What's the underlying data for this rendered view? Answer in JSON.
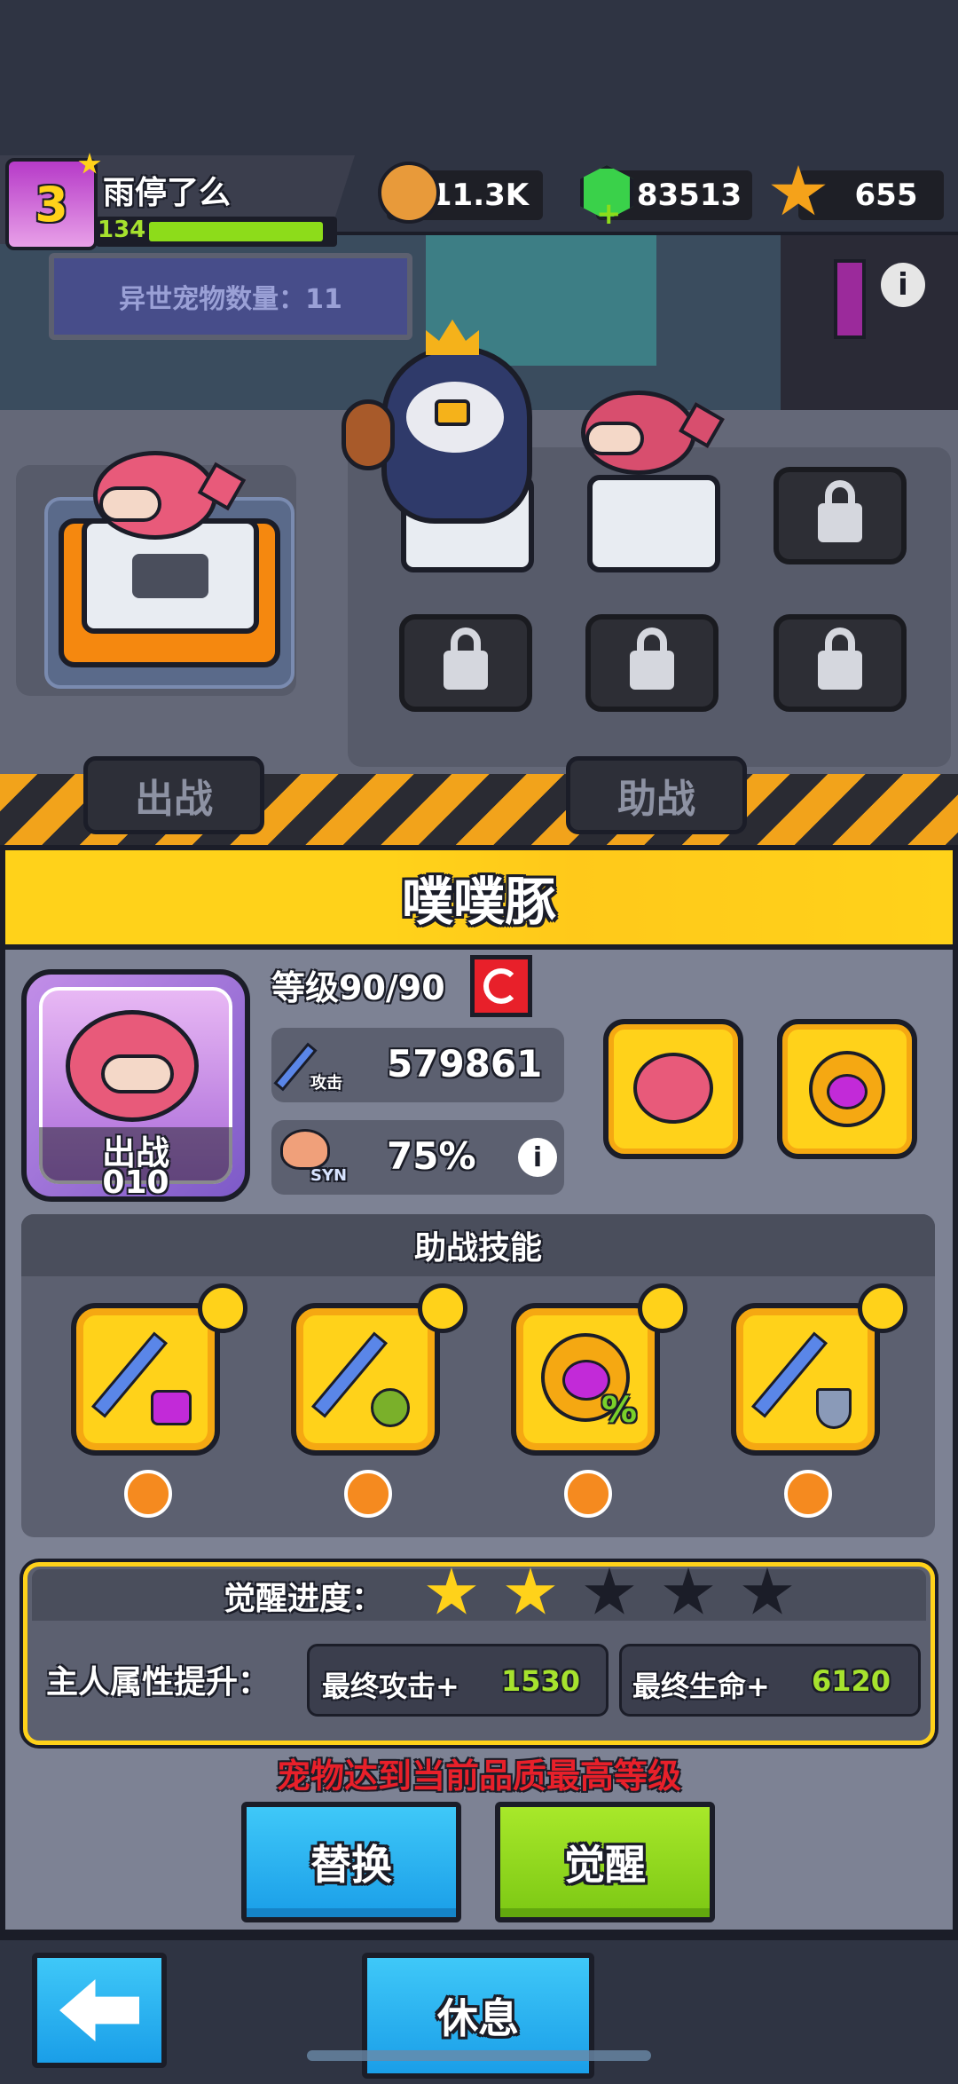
{
  "player": {
    "avatar_badge": "3",
    "name": "雨停了么",
    "level": "134",
    "xp_progress": 0.95
  },
  "currencies": {
    "coins": "11.3K",
    "gems": "83513",
    "stars": "655"
  },
  "scene": {
    "pet_count_label": "异世宠物数量：11",
    "info_icon": "i",
    "battle_label": "出战",
    "assist_label": "助战"
  },
  "pet": {
    "name": "噗噗豚",
    "level_label": "等级90/90",
    "attack_label": "攻击",
    "attack_value": "579861",
    "syn_label": "SYN",
    "syn_value": "75%",
    "card_status": "出战",
    "card_number": "010"
  },
  "assist_skills": {
    "title": "助战技能",
    "skills": [
      {
        "icon": "sword-purple-debuff-icon"
      },
      {
        "icon": "sword-poison-skull-icon"
      },
      {
        "icon": "cat-orb-percent-icon"
      },
      {
        "icon": "sword-shield-icon"
      }
    ]
  },
  "awakening": {
    "progress_label": "觉醒进度：",
    "stars_filled": 2,
    "stars_total": 5,
    "owner_boost_label": "主人属性提升：",
    "final_attack_label": "最终攻击+",
    "final_attack_value": "1530",
    "final_hp_label": "最终生命+",
    "final_hp_value": "6120"
  },
  "notice": "宠物达到当前品质最高等级",
  "buttons": {
    "replace": "替换",
    "awaken": "觉醒",
    "rest": "休息"
  },
  "colors": {
    "yellow": "#ffd21a",
    "blue_button": "#1fb6f0",
    "green_button": "#8ddc1a",
    "notice_red": "#e8202a",
    "stat_green": "#a6e22e"
  }
}
